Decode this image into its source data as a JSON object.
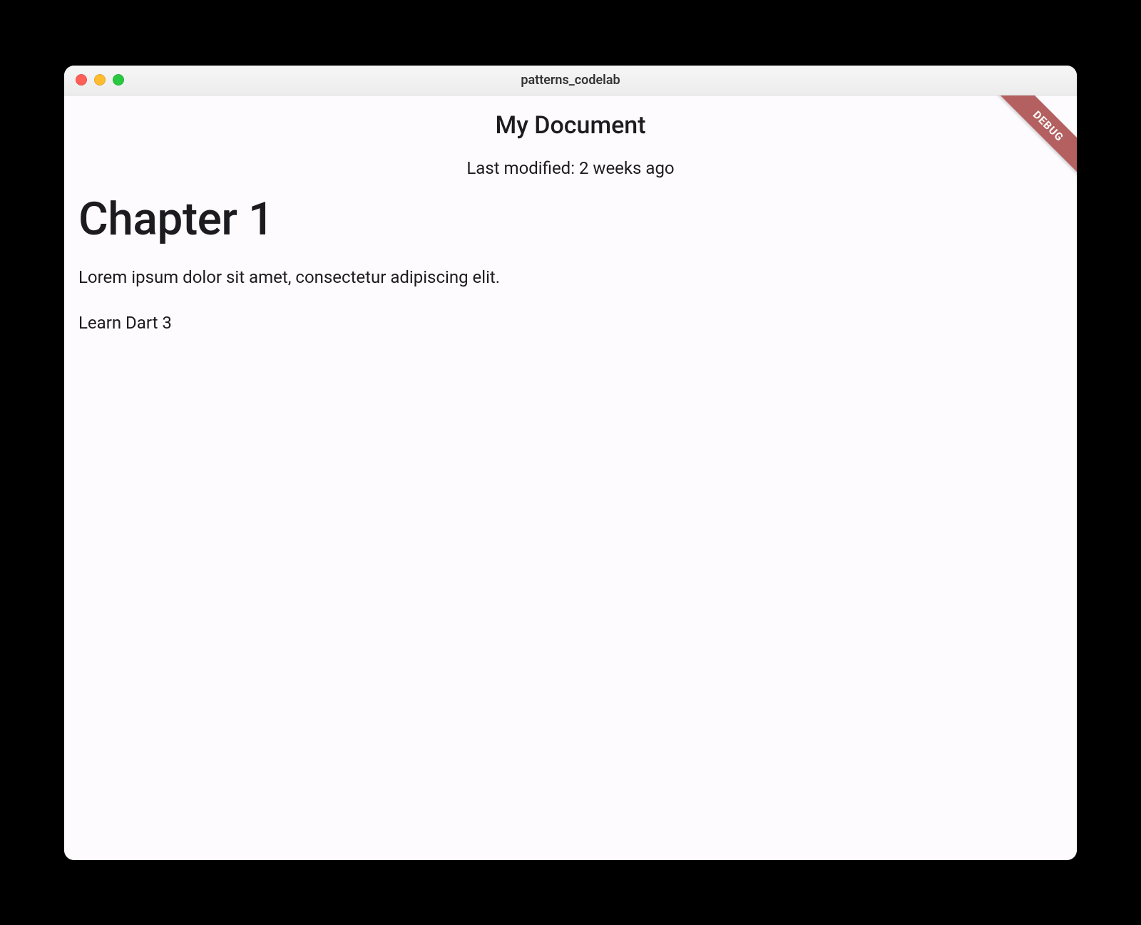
{
  "window": {
    "title": "patterns_codelab"
  },
  "debug_banner": "DEBUG",
  "header": {
    "title": "My Document",
    "last_modified": "Last modified: 2 weeks ago"
  },
  "content": {
    "heading": "Chapter 1",
    "paragraph": "Lorem ipsum dolor sit amet, consectetur adipiscing elit.",
    "list_item": "Learn Dart 3"
  }
}
